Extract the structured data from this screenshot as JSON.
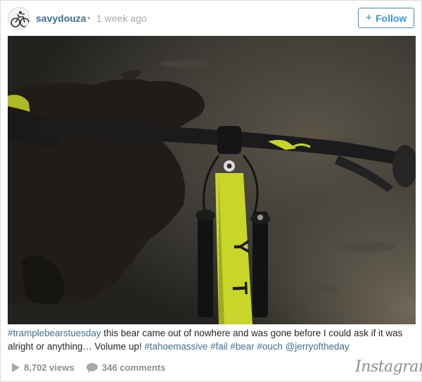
{
  "post": {
    "username": "savydouza",
    "separator": "•",
    "time_ago": "1 week ago",
    "follow_label": "Follow",
    "follow_plus": "+"
  },
  "photo": {
    "frame_letters": "YT"
  },
  "caption": {
    "hashtag_1": "#tramplebearstuesday",
    "text": " this bear came out of nowhere and was gone before I could ask if it was alright or anything… Volume up! ",
    "tags_end": [
      "#tahoemassive",
      "#fail",
      "#bear",
      "#ouch",
      "@jerryoftheday"
    ]
  },
  "stats": {
    "views": "8,702 views",
    "comments": "346 comments"
  },
  "brand": "Instagram",
  "colors": {
    "link": "#3f729b",
    "follow": "#3897f0",
    "muted": "#8e8e8e",
    "bike_yellow": "#c8d62b"
  }
}
